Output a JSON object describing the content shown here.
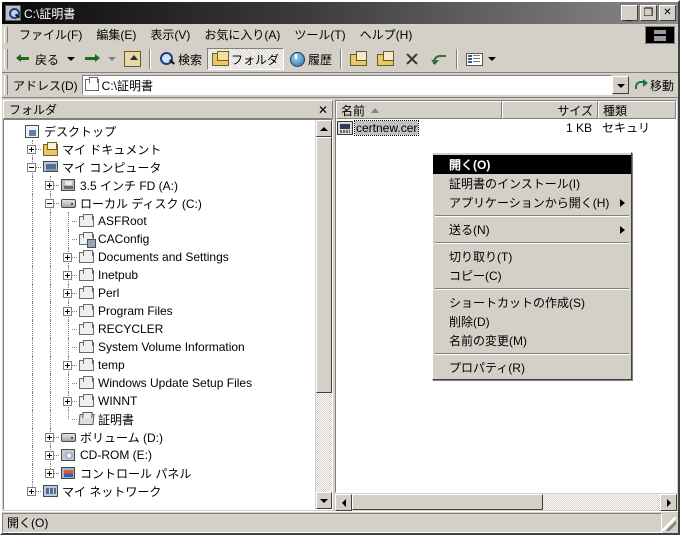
{
  "window": {
    "title": "C:\\証明書",
    "icon": "folder-search-icon",
    "minimize_label": "_",
    "maximize_label": "❐",
    "close_label": "✕"
  },
  "menubar": {
    "items": [
      {
        "label": "ファイル(F)",
        "name": "menu-file"
      },
      {
        "label": "編集(E)",
        "name": "menu-edit"
      },
      {
        "label": "表示(V)",
        "name": "menu-view"
      },
      {
        "label": "お気に入り(A)",
        "name": "menu-favorites"
      },
      {
        "label": "ツール(T)",
        "name": "menu-tools"
      },
      {
        "label": "ヘルプ(H)",
        "name": "menu-help"
      }
    ],
    "logo": "windows-logo-icon"
  },
  "toolbar": {
    "back_label": "戻る",
    "forward_label": "",
    "up_label": "",
    "search_label": "検索",
    "folders_label": "フォルダ",
    "history_label": "履歴",
    "moveto_label": "",
    "copyto_label": "",
    "delete_label": "",
    "undo_label": "",
    "views_label": ""
  },
  "address": {
    "label": "アドレス(D)",
    "value": "C:\\証明書",
    "go_label": "移動"
  },
  "folders_pane": {
    "header": "フォルダ",
    "close_label": "✕",
    "tree": [
      {
        "label": "デスクトップ",
        "indent": 0,
        "icon": "desktop-icon",
        "expander": "none"
      },
      {
        "label": "マイ ドキュメント",
        "indent": 1,
        "icon": "my-documents-icon",
        "expander": "plus"
      },
      {
        "label": "マイ コンピュータ",
        "indent": 1,
        "icon": "my-computer-icon",
        "expander": "minus"
      },
      {
        "label": "3.5 インチ FD (A:)",
        "indent": 2,
        "icon": "floppy-drive-icon",
        "expander": "plus"
      },
      {
        "label": "ローカル ディスク (C:)",
        "indent": 2,
        "icon": "hard-disk-icon",
        "expander": "minus"
      },
      {
        "label": "ASFRoot",
        "indent": 3,
        "icon": "folder-icon",
        "expander": "none"
      },
      {
        "label": "CAConfig",
        "indent": 3,
        "icon": "folder-shared-icon",
        "expander": "none"
      },
      {
        "label": "Documents and Settings",
        "indent": 3,
        "icon": "folder-icon",
        "expander": "plus"
      },
      {
        "label": "Inetpub",
        "indent": 3,
        "icon": "folder-icon",
        "expander": "plus"
      },
      {
        "label": "Perl",
        "indent": 3,
        "icon": "folder-icon",
        "expander": "plus"
      },
      {
        "label": "Program Files",
        "indent": 3,
        "icon": "folder-icon",
        "expander": "plus"
      },
      {
        "label": "RECYCLER",
        "indent": 3,
        "icon": "folder-icon",
        "expander": "none"
      },
      {
        "label": "System Volume Information",
        "indent": 3,
        "icon": "folder-icon",
        "expander": "none"
      },
      {
        "label": "temp",
        "indent": 3,
        "icon": "folder-icon",
        "expander": "plus"
      },
      {
        "label": "Windows Update Setup Files",
        "indent": 3,
        "icon": "folder-icon",
        "expander": "none"
      },
      {
        "label": "WINNT",
        "indent": 3,
        "icon": "folder-icon",
        "expander": "plus"
      },
      {
        "label": "証明書",
        "indent": 3,
        "icon": "folder-open-icon",
        "expander": "none"
      },
      {
        "label": "ボリューム (D:)",
        "indent": 2,
        "icon": "hard-disk-icon",
        "expander": "plus"
      },
      {
        "label": "CD-ROM (E:)",
        "indent": 2,
        "icon": "cdrom-drive-icon",
        "expander": "plus"
      },
      {
        "label": "コントロール パネル",
        "indent": 2,
        "icon": "control-panel-icon",
        "expander": "plus"
      },
      {
        "label": "マイ ネットワーク",
        "indent": 1,
        "icon": "network-icon",
        "expander": "plus"
      }
    ]
  },
  "file_list": {
    "columns": [
      {
        "label": "名前",
        "name": "column-name",
        "sorted": true
      },
      {
        "label": "サイズ",
        "name": "column-size",
        "sorted": false
      },
      {
        "label": "種類",
        "name": "column-type",
        "sorted": false
      }
    ],
    "rows": [
      {
        "name": "certnew.cer",
        "size": "1 KB",
        "type": "セキュリ",
        "icon": "certificate-icon",
        "selected": true
      }
    ]
  },
  "context_menu": {
    "items": [
      {
        "label": "開く(O)",
        "bold": true,
        "selected": true,
        "submenu": false,
        "separator_after": false
      },
      {
        "label": "証明書のインストール(I)",
        "bold": false,
        "selected": false,
        "submenu": false,
        "separator_after": false
      },
      {
        "label": "アプリケーションから開く(H)",
        "bold": false,
        "selected": false,
        "submenu": true,
        "separator_after": true
      },
      {
        "label": "送る(N)",
        "bold": false,
        "selected": false,
        "submenu": true,
        "separator_after": true
      },
      {
        "label": "切り取り(T)",
        "bold": false,
        "selected": false,
        "submenu": false,
        "separator_after": false
      },
      {
        "label": "コピー(C)",
        "bold": false,
        "selected": false,
        "submenu": false,
        "separator_after": true
      },
      {
        "label": "ショートカットの作成(S)",
        "bold": false,
        "selected": false,
        "submenu": false,
        "separator_after": false
      },
      {
        "label": "削除(D)",
        "bold": false,
        "selected": false,
        "submenu": false,
        "separator_after": false
      },
      {
        "label": "名前の変更(M)",
        "bold": false,
        "selected": false,
        "submenu": false,
        "separator_after": true
      },
      {
        "label": "プロパティ(R)",
        "bold": false,
        "selected": false,
        "submenu": false,
        "separator_after": false
      }
    ]
  },
  "statusbar": {
    "text": "開く(O)"
  }
}
